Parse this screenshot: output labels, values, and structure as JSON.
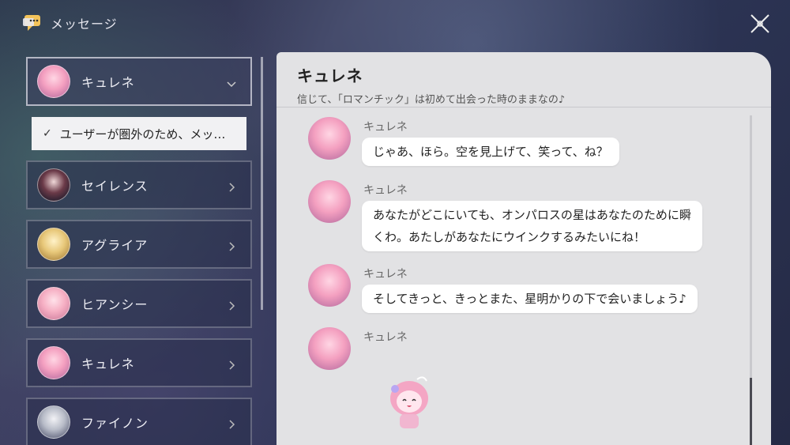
{
  "header": {
    "title": "メッセージ"
  },
  "contacts": [
    {
      "name": "キュレネ",
      "active": true,
      "avatar": "pink"
    },
    {
      "name": "セイレンス",
      "active": false,
      "avatar": "dark"
    },
    {
      "name": "アグライア",
      "active": false,
      "avatar": "gold"
    },
    {
      "name": "ヒアンシー",
      "active": false,
      "avatar": "rose"
    },
    {
      "name": "キュレネ",
      "active": false,
      "avatar": "pink"
    },
    {
      "name": "ファイノン",
      "active": false,
      "avatar": "silver"
    }
  ],
  "sub_item": {
    "check": "✓",
    "label": "ユーザーが圏外のため、メッ…"
  },
  "chat": {
    "title": "キュレネ",
    "subtitle": "信じて、「ロマンチック」は初めて出会った時のままなの♪",
    "messages": [
      {
        "sender": "キュレネ",
        "lines": [
          "じゃあ、ほら。空を見上げて、笑って、ね？"
        ]
      },
      {
        "sender": "キュレネ",
        "lines": [
          "あなたがどこにいても、オンパロスの星はあなたのために瞬",
          "くわ。あたしがあなたにウインクするみたいにね！"
        ]
      },
      {
        "sender": "キュレネ",
        "lines": [
          "そしてきっと、きっとまた、星明かりの下で会いましょう♪"
        ]
      },
      {
        "sender": "キュレネ",
        "sticker": "chibi-sticker"
      }
    ]
  },
  "icons": {
    "header": "message-bubble-icon",
    "close": "close-icon",
    "chevron": "chevron-right-icon"
  },
  "colors": {
    "chat_bg": "#e2e2e4",
    "bubble_bg": "#ffffff",
    "sub_item_bg": "#f1f1f3"
  }
}
